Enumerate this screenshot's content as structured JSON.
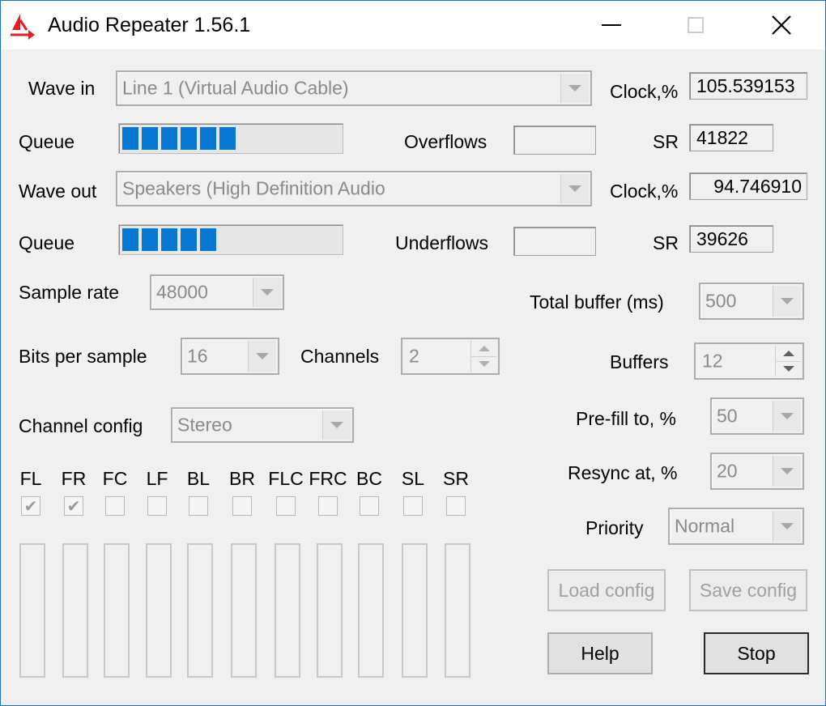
{
  "window": {
    "title": "Audio Repeater 1.56.1"
  },
  "input": {
    "wave_in_label": "Wave in",
    "wave_in_value": "Line 1 (Virtual Audio Cable)",
    "queue_label": "Queue",
    "queue_level": 0.58,
    "overflows_label": "Overflows",
    "overflows_value": "",
    "clock_label": "Clock,%",
    "clock_value": "105.539153",
    "sr_label": "SR",
    "sr_value": "41822"
  },
  "output": {
    "wave_out_label": "Wave out",
    "wave_out_value": "Speakers (High Definition Audio",
    "queue_label": "Queue",
    "queue_level": 0.42,
    "underflows_label": "Underflows",
    "underflows_value": "",
    "clock_label": "Clock,%",
    "clock_value": "94.746910",
    "sr_label": "SR",
    "sr_value": "39626"
  },
  "format": {
    "sample_rate_label": "Sample rate",
    "sample_rate_value": "48000",
    "bits_label": "Bits per sample",
    "bits_value": "16",
    "channels_label": "Channels",
    "channels_value": "2",
    "channel_config_label": "Channel config",
    "channel_config_value": "Stereo"
  },
  "buffer": {
    "total_label": "Total buffer (ms)",
    "total_value": "500",
    "buffers_label": "Buffers",
    "buffers_value": "12",
    "prefill_label": "Pre-fill to, %",
    "prefill_value": "50",
    "resync_label": "Resync at, %",
    "resync_value": "20",
    "priority_label": "Priority",
    "priority_value": "Normal"
  },
  "channels": [
    {
      "label": "FL",
      "checked": true
    },
    {
      "label": "FR",
      "checked": true
    },
    {
      "label": "FC",
      "checked": false
    },
    {
      "label": "LF",
      "checked": false
    },
    {
      "label": "BL",
      "checked": false
    },
    {
      "label": "BR",
      "checked": false
    },
    {
      "label": "FLC",
      "checked": false
    },
    {
      "label": "FRC",
      "checked": false
    },
    {
      "label": "BC",
      "checked": false
    },
    {
      "label": "SL",
      "checked": false
    },
    {
      "label": "SR",
      "checked": false
    }
  ],
  "buttons": {
    "load": "Load config",
    "save": "Save config",
    "help": "Help",
    "stop": "Stop"
  },
  "colors": {
    "queue_fill": "#0678d4",
    "title_border": "#1a73d1"
  }
}
